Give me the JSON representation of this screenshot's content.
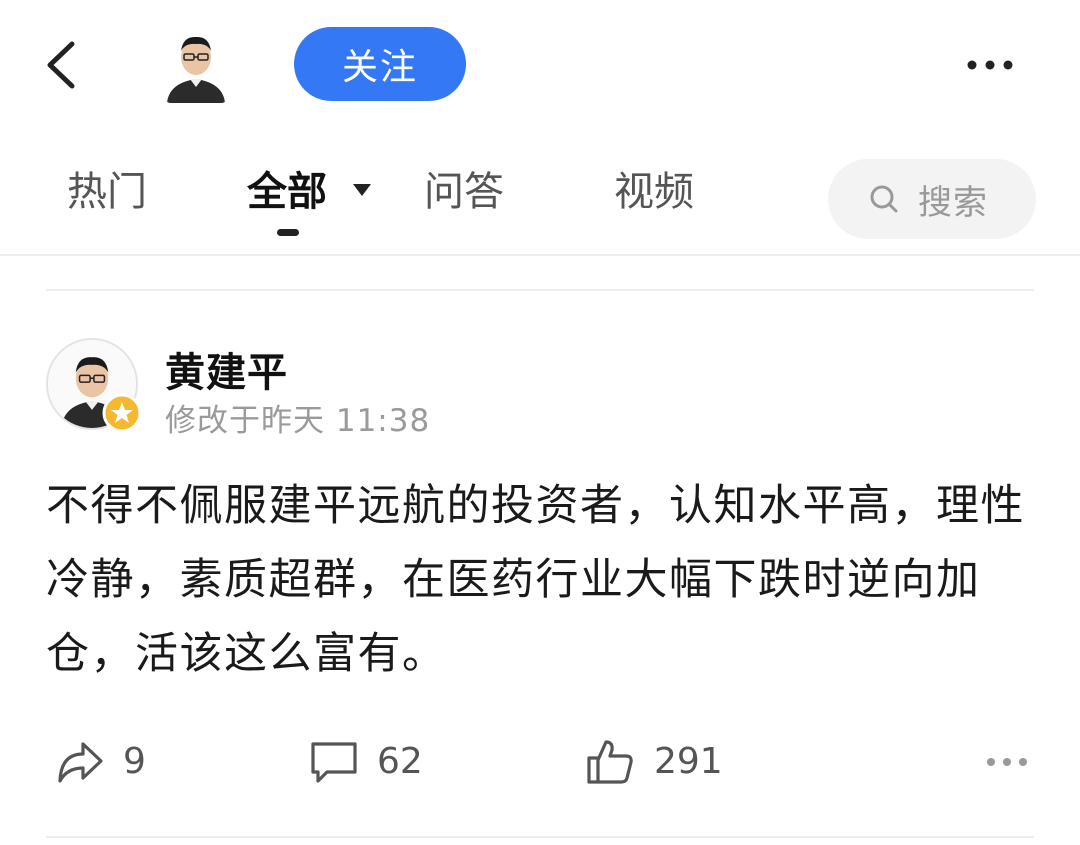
{
  "header": {
    "back_icon": "back-arrow-icon",
    "follow_label": "关注",
    "more_icon": "more-horizontal-icon"
  },
  "tabs": [
    {
      "label": "热门",
      "active": false
    },
    {
      "label": "全部",
      "active": true,
      "has_dropdown": true
    },
    {
      "label": "问答",
      "active": false
    },
    {
      "label": "视频",
      "active": false
    }
  ],
  "search": {
    "icon": "search-icon",
    "label": "搜索"
  },
  "post": {
    "author": "黄建平",
    "time": "修改于昨天 11:38",
    "content": "不得不佩服建平远航的投资者，认知水平高，理性冷静，素质超群，在医药行业大幅下跌时逆向加仓，活该这么富有。",
    "badge_icon": "verified-star-badge-icon",
    "actions": {
      "share_count": "9",
      "comment_count": "62",
      "like_count": "291"
    }
  },
  "colors": {
    "accent": "#3478f6",
    "badge": "#f5b82e"
  }
}
